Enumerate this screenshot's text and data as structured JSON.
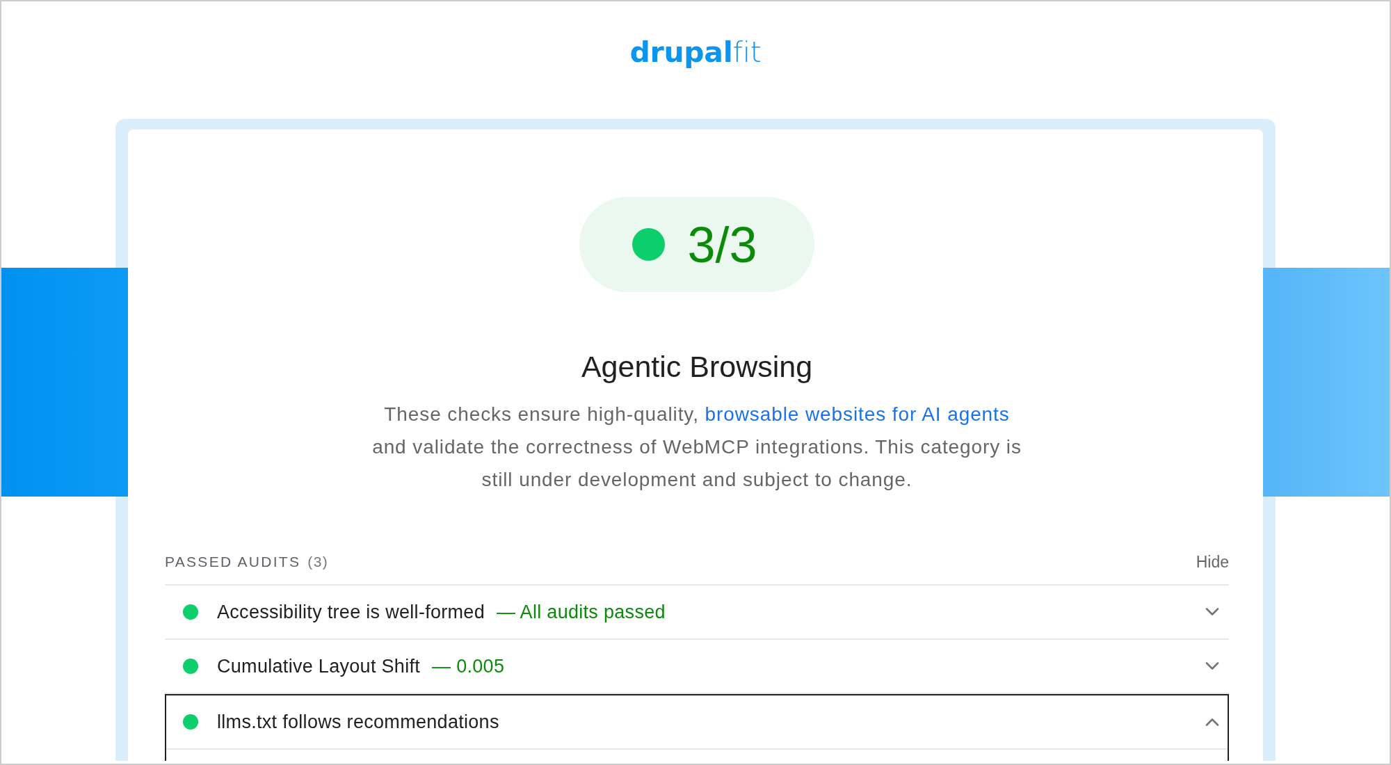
{
  "logo": {
    "primary": "drupal",
    "secondary": "fit"
  },
  "category": {
    "score": {
      "value": "3/3"
    },
    "title": "Agentic Browsing",
    "description": {
      "before_link": "These checks ensure high-quality, ",
      "link": "browsable websites for AI agents",
      "after_link": " and validate the correctness of WebMCP integrations. This category is still under development and subject to change."
    }
  },
  "audit_group": {
    "title": "PASSED AUDITS",
    "count": "(3)",
    "toggle": "Hide",
    "audits": [
      {
        "title": "Accessibility tree is well-formed",
        "display_value": "— All audits passed",
        "expanded": false
      },
      {
        "title": "Cumulative Layout Shift",
        "display_value": "— 0.005",
        "expanded": false
      },
      {
        "title": "llms.txt follows recommendations",
        "expanded": true
      }
    ]
  }
}
